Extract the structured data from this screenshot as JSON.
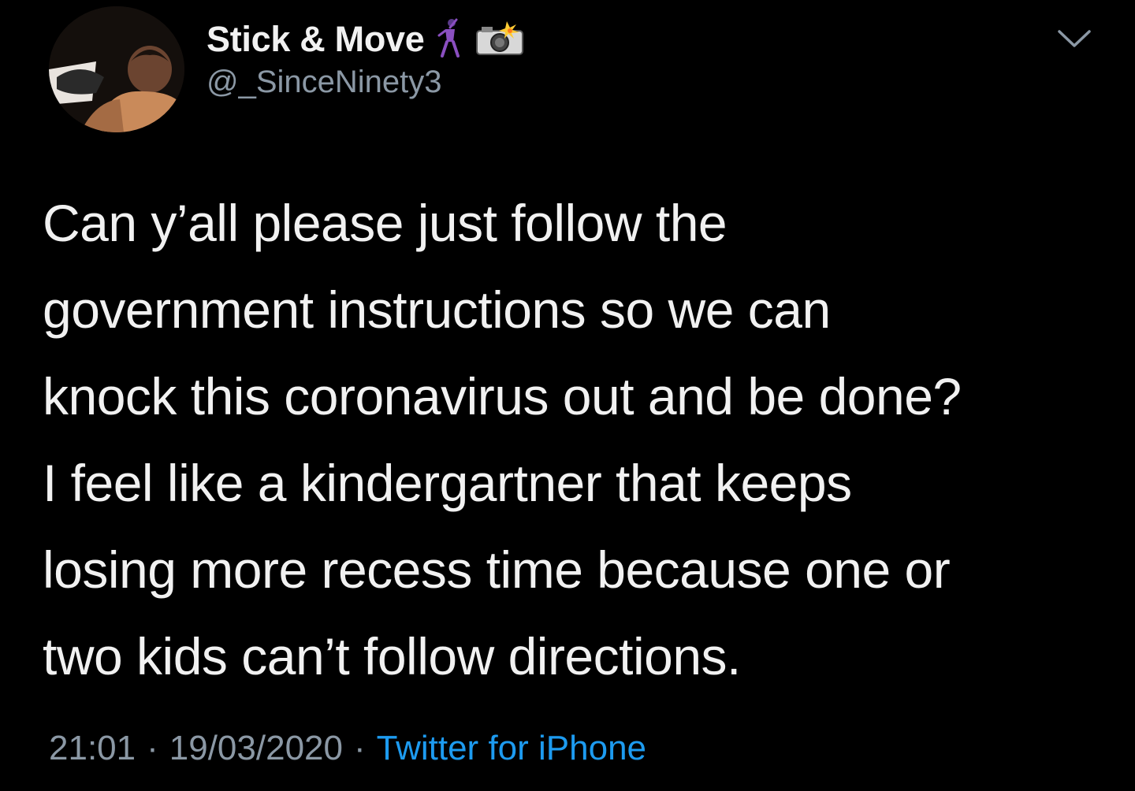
{
  "user": {
    "display_name": "Stick & Move",
    "handle": "@_SinceNinety3",
    "emoji": [
      "dancing-man-emoji",
      "camera-with-flash-emoji"
    ]
  },
  "tweet": {
    "lines": [
      "Can y’all please just follow the",
      "government instructions so we can",
      "knock this coronavirus out and be done?",
      "I feel like a kindergartner that keeps",
      "losing more recess time because one or",
      "two kids can’t follow directions."
    ]
  },
  "meta": {
    "time": "21:01",
    "date": "19/03/2020",
    "separator": "·",
    "source": "Twitter for iPhone"
  },
  "colors": {
    "background": "#000000",
    "text": "#f1f1f1",
    "secondary": "#8b98a5",
    "link": "#1d9bf0"
  }
}
